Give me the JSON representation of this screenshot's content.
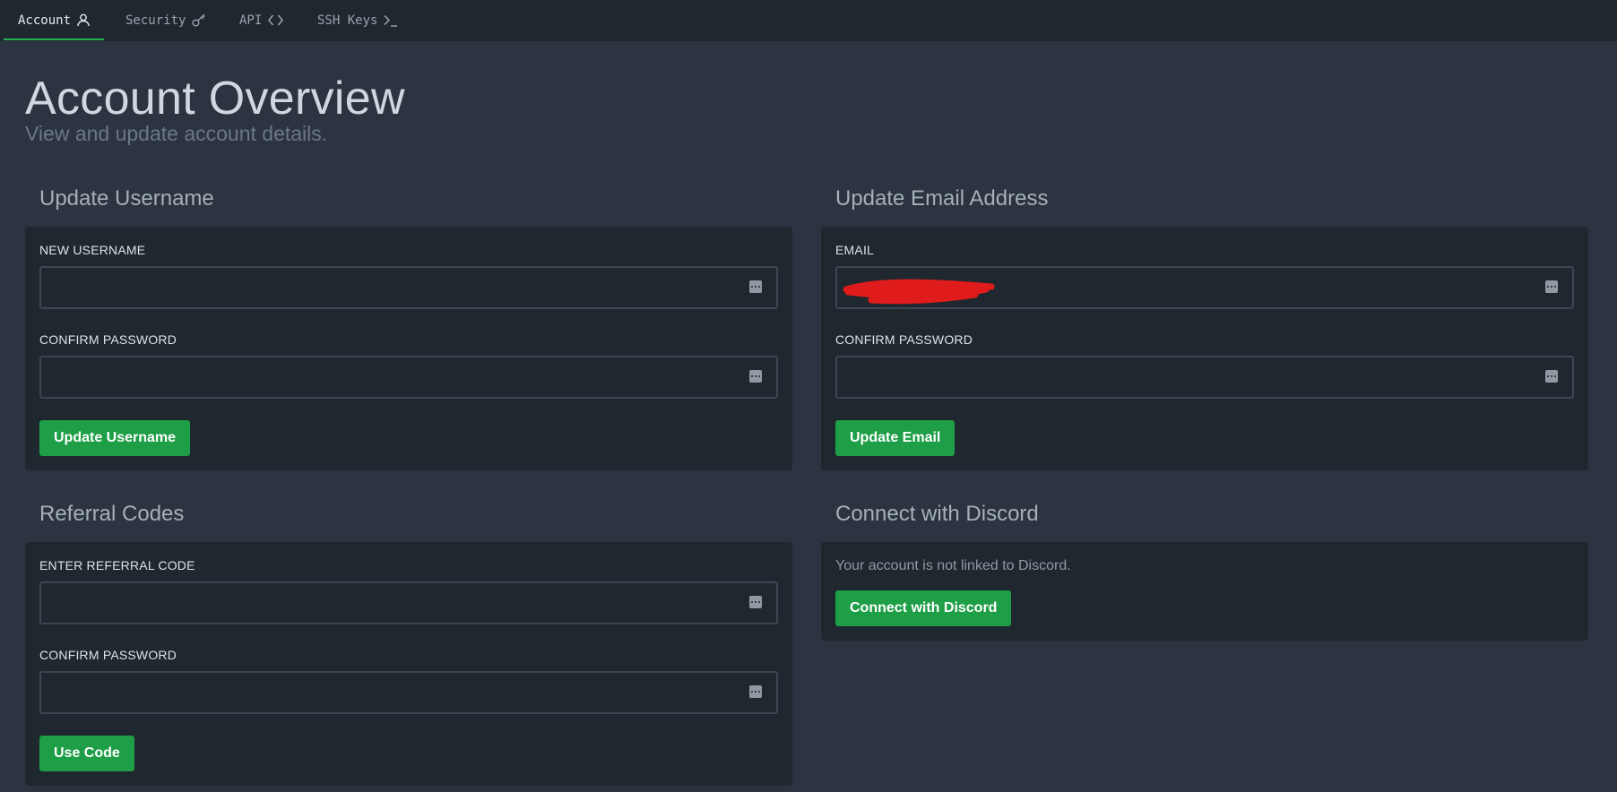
{
  "tabs": [
    {
      "label": "Account",
      "icon": "user-icon",
      "active": true
    },
    {
      "label": "Security",
      "icon": "key-icon",
      "active": false
    },
    {
      "label": "API",
      "icon": "code-brackets-icon",
      "active": false
    },
    {
      "label": "SSH Keys",
      "icon": "terminal-prompt-icon",
      "active": false
    }
  ],
  "page": {
    "title": "Account Overview",
    "subtitle": "View and update account details."
  },
  "username_section": {
    "title": "Update Username",
    "new_username_label": "NEW USERNAME",
    "new_username_value": "",
    "confirm_password_label": "CONFIRM PASSWORD",
    "confirm_password_value": "",
    "button_label": "Update Username"
  },
  "email_section": {
    "title": "Update Email Address",
    "email_label": "EMAIL",
    "email_value": "",
    "email_redacted": true,
    "confirm_password_label": "CONFIRM PASSWORD",
    "confirm_password_value": "",
    "button_label": "Update Email"
  },
  "referral_section": {
    "title": "Referral Codes",
    "code_label": "ENTER REFERRAL CODE",
    "code_value": "",
    "confirm_password_label": "CONFIRM PASSWORD",
    "confirm_password_value": "",
    "button_label": "Use Code"
  },
  "discord_section": {
    "title": "Connect with Discord",
    "status_text": "Your account is not linked to Discord.",
    "button_label": "Connect with Discord"
  },
  "colors": {
    "background": "#2b3440",
    "card": "#1f272f",
    "accent_green": "#1e9e46",
    "redaction": "#e01b1b"
  }
}
